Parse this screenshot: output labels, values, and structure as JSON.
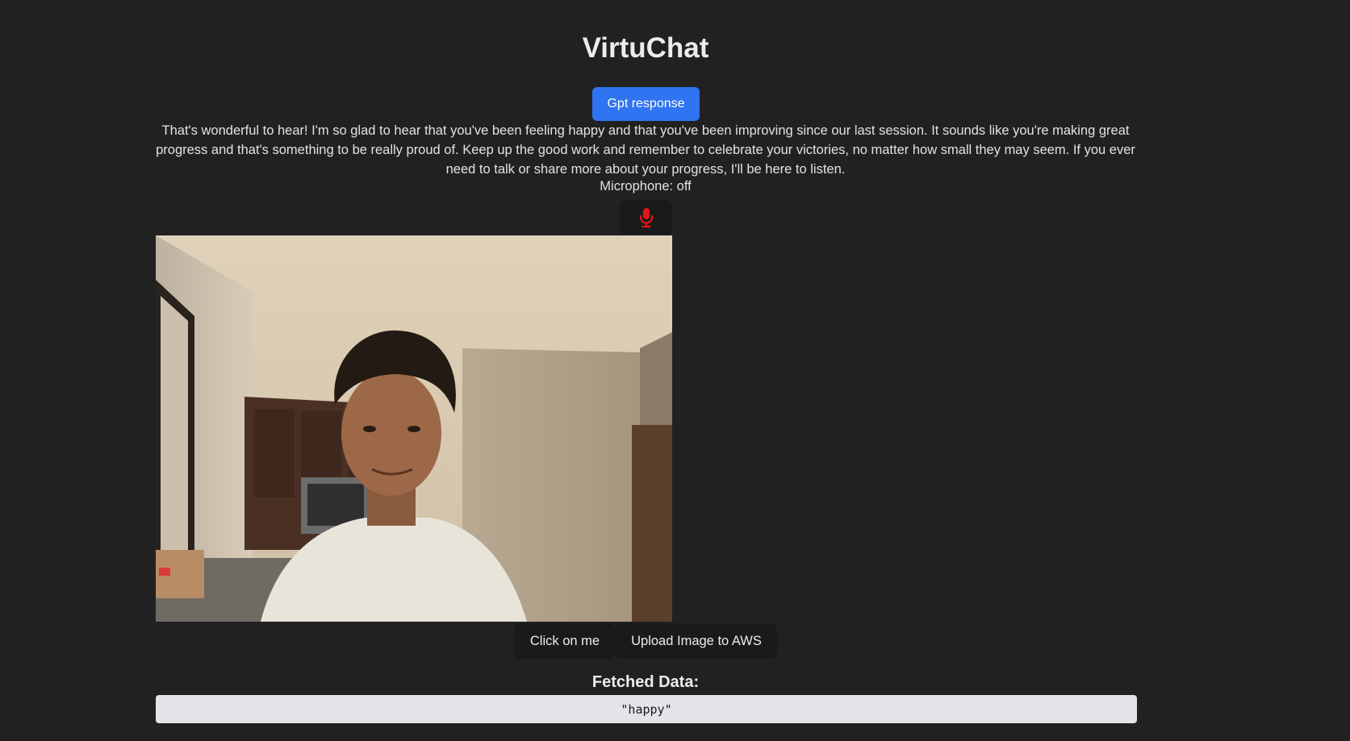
{
  "app": {
    "title": "VirtuChat"
  },
  "gpt": {
    "button_label": "Gpt response",
    "response_text": "That's wonderful to hear! I'm so glad to hear that you've been feeling happy and that you've been improving since our last session. It sounds like you're making great progress and that's something to be really proud of. Keep up the good work and remember to celebrate your victories, no matter how small they may seem. If you ever need to talk or share more about your progress, I'll be here to listen."
  },
  "microphone": {
    "status_text": "Microphone: off",
    "icon": "microphone-icon",
    "icon_color": "#e8141a"
  },
  "actions": {
    "click_label": "Click on me",
    "upload_label": "Upload Image to AWS"
  },
  "fetched": {
    "label": "Fetched Data:",
    "value": "\"happy\""
  },
  "colors": {
    "background": "#212121",
    "primary_button": "#2f74f0",
    "dark_button": "#1a1a1a",
    "result_box": "#e3e4e8"
  }
}
